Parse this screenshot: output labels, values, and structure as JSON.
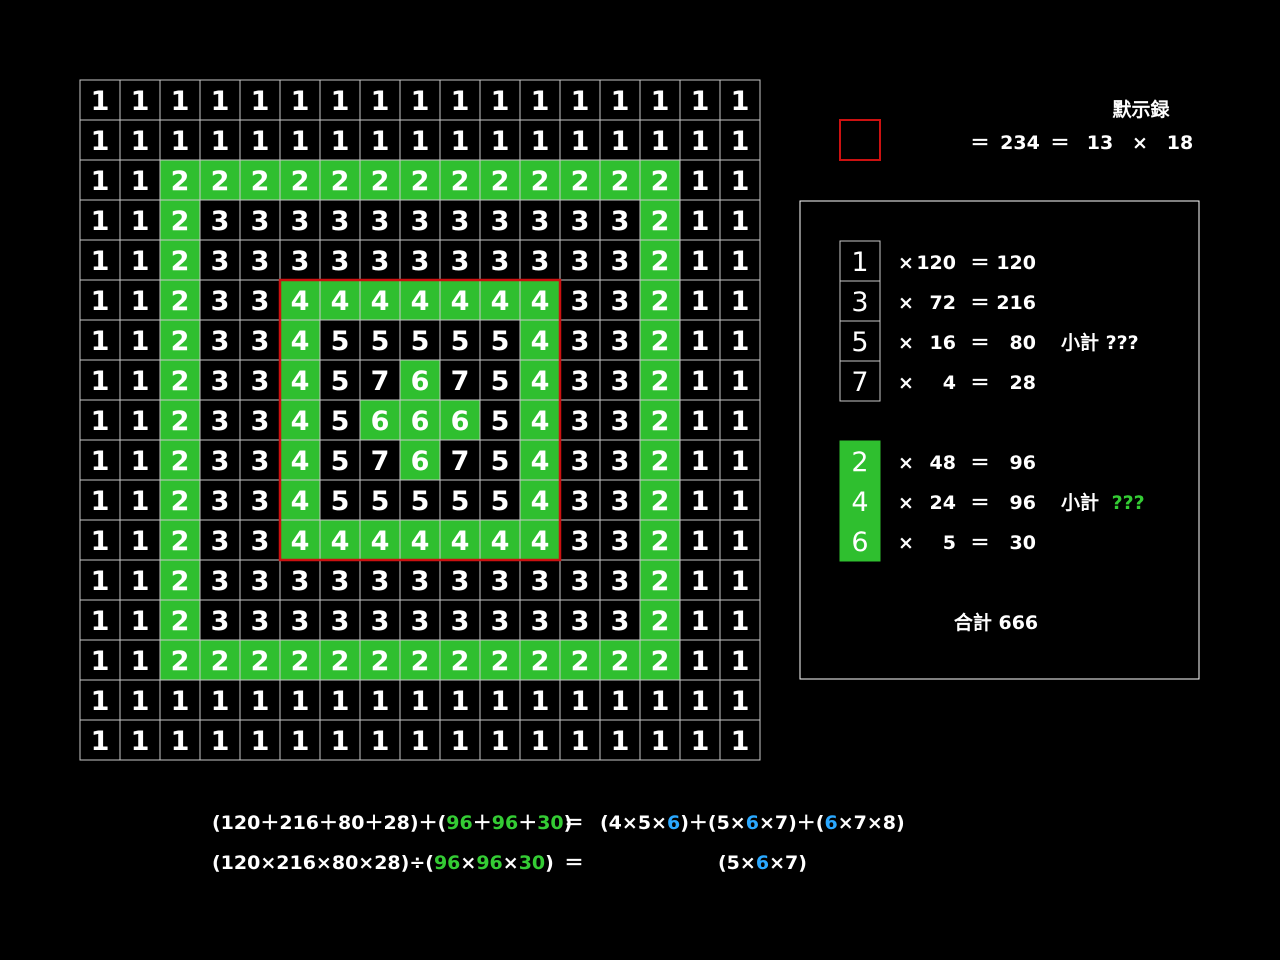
{
  "colors": {
    "background": "#000000",
    "green": "#2fbf2f",
    "green_text": "#34cc34",
    "red": "#cc1111",
    "blue": "#2aa8ff",
    "grid_line": "#c8c8c8",
    "text": "#ffffff"
  },
  "grid": {
    "rows": [
      "11111111111111111",
      "11111111111111111",
      "11222222222222211",
      "11233333333333211",
      "11233333333333211",
      "11233444444433211",
      "11233455555433211",
      "11233457675433211",
      "11233456665433211",
      "11233457675433211",
      "11233455555433211",
      "11233444444433211",
      "11233333333333211",
      "11233333333333211",
      "11222222222222211",
      "11111111111111111",
      "11111111111111111"
    ],
    "green_values": [
      "2",
      "4",
      "6"
    ]
  },
  "header": {
    "title": "默示録",
    "eq1": "＝",
    "value": "234",
    "eq2": "＝",
    "factor_a": "13",
    "times": "×",
    "factor_b": "18"
  },
  "summary": {
    "odd": [
      {
        "label": "1",
        "times": "×",
        "count": "120",
        "eq": "＝",
        "product": "120"
      },
      {
        "label": "3",
        "times": "×",
        "count": "72",
        "eq": "＝",
        "product": "216"
      },
      {
        "label": "5",
        "times": "×",
        "count": "16",
        "eq": "＝",
        "product": "80"
      },
      {
        "label": "7",
        "times": "×",
        "count": "4",
        "eq": "＝",
        "product": "28"
      }
    ],
    "odd_subtotal": "小計 ???",
    "even": [
      {
        "label": "2",
        "times": "×",
        "count": "48",
        "eq": "＝",
        "product": "96"
      },
      {
        "label": "4",
        "times": "×",
        "count": "24",
        "eq": "＝",
        "product": "96"
      },
      {
        "label": "6",
        "times": "×",
        "count": "5",
        "eq": "＝",
        "product": "30"
      }
    ],
    "even_subtotal_label": "小計",
    "even_subtotal_value": "???",
    "total": "合計 666"
  },
  "equations": {
    "line1": [
      {
        "t": "(120＋216＋80＋28)＋(",
        "c": "w"
      },
      {
        "t": "96",
        "c": "g"
      },
      {
        "t": "＋",
        "c": "w"
      },
      {
        "t": "96",
        "c": "g"
      },
      {
        "t": "＋",
        "c": "w"
      },
      {
        "t": "30",
        "c": "g"
      },
      {
        "t": ")",
        "c": "w"
      }
    ],
    "line1_eq": "＝",
    "line1_rhs": [
      {
        "t": "(4×5×",
        "c": "w"
      },
      {
        "t": "6",
        "c": "b"
      },
      {
        "t": ")＋(5×",
        "c": "w"
      },
      {
        "t": "6",
        "c": "b"
      },
      {
        "t": "×7)＋(",
        "c": "w"
      },
      {
        "t": "6",
        "c": "b"
      },
      {
        "t": "×7×8)",
        "c": "w"
      }
    ],
    "line2": [
      {
        "t": "(120×216×80×28)÷(",
        "c": "w"
      },
      {
        "t": "96",
        "c": "g"
      },
      {
        "t": "×",
        "c": "w"
      },
      {
        "t": "96",
        "c": "g"
      },
      {
        "t": "×",
        "c": "w"
      },
      {
        "t": "30",
        "c": "g"
      },
      {
        "t": ")",
        "c": "w"
      }
    ],
    "line2_eq": "＝",
    "line2_rhs": [
      {
        "t": "(5×",
        "c": "w"
      },
      {
        "t": "6",
        "c": "b"
      },
      {
        "t": "×7)",
        "c": "w"
      }
    ]
  }
}
